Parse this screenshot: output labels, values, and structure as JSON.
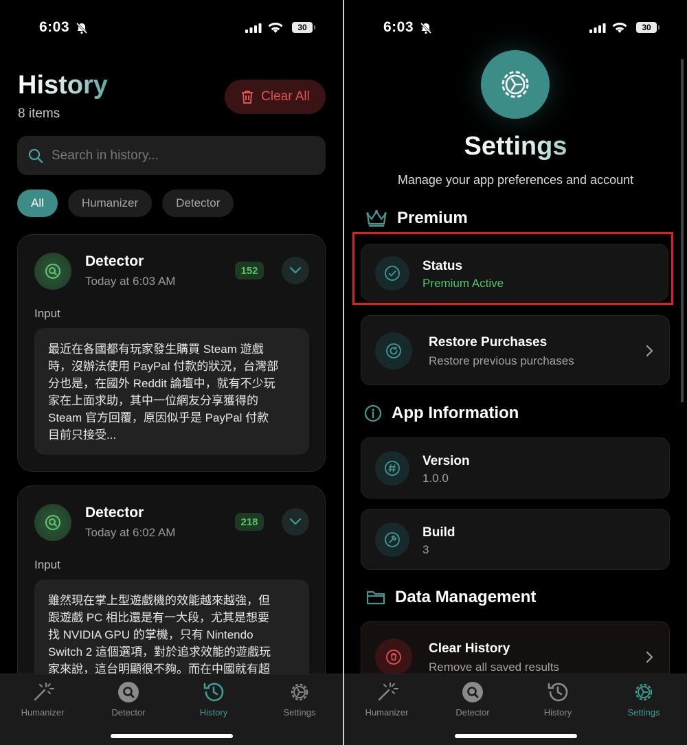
{
  "status_bar": {
    "time": "6:03",
    "battery": "30"
  },
  "history": {
    "title": "History",
    "count": "8 items",
    "clear_all_label": "Clear All",
    "search_placeholder": "Search in history...",
    "filters": [
      "All",
      "Humanizer",
      "Detector"
    ],
    "input_label": "Input",
    "cards": [
      {
        "title": "Detector",
        "time": "Today at 6:03 AM",
        "badge": "152",
        "input_text": "最近在各國都有玩家發生購買 Steam 遊戲\n時，沒辦法使用 PayPal 付款的狀況，台灣部\n分也是，在國外 Reddit 論壇中，就有不少玩\n家在上面求助，其中一位網友分享獲得的\nSteam 官方回覆，原因似乎是 PayPal 付款\n目前只接受..."
      },
      {
        "title": "Detector",
        "time": "Today at 6:02 AM",
        "badge": "218",
        "input_text": "雖然現在掌上型遊戲機的效能越來越強，但\n跟遊戲 PC 相比還是有一大段，尤其是想要\n找 NVIDIA GPU 的掌機，只有 Nintendo\nSwitch 2 這個選項，對於追求效能的遊戲玩\n家來說，這台明顯很不夠。而在中國就有超"
      }
    ]
  },
  "tabs": [
    {
      "label": "Humanizer",
      "icon": "wand-sparkle-icon"
    },
    {
      "label": "Detector",
      "icon": "search-circle-icon"
    },
    {
      "label": "History",
      "icon": "history-clock-icon"
    },
    {
      "label": "Settings",
      "icon": "gear-icon"
    }
  ],
  "settings": {
    "title": "Settings",
    "subtitle": "Manage your app preferences and account",
    "premium_section": "Premium",
    "status_title": "Status",
    "status_value": "Premium Active",
    "restore_title": "Restore Purchases",
    "restore_sub": "Restore previous purchases",
    "app_info_section": "App Information",
    "version_title": "Version",
    "version_value": "1.0.0",
    "build_title": "Build",
    "build_value": "3",
    "data_section": "Data Management",
    "clear_history_title": "Clear History",
    "clear_history_sub": "Remove all saved results"
  },
  "colors": {
    "accent": "#3c8c87",
    "danger": "#e05252",
    "success": "#54c466",
    "highlight_box": "#e01f1f"
  }
}
